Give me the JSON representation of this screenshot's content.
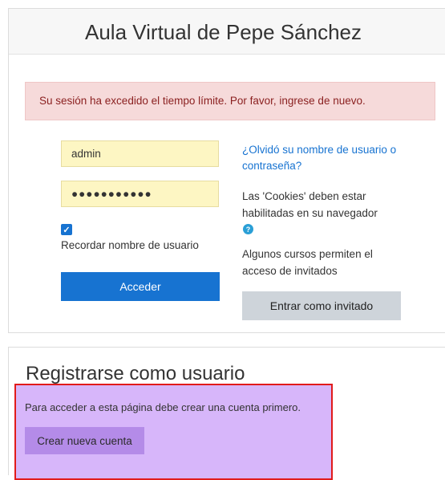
{
  "header": {
    "title": "Aula Virtual de Pepe Sánchez"
  },
  "alert": {
    "message": "Su sesión ha excedido el tiempo límite. Por favor, ingrese de nuevo."
  },
  "login": {
    "username_value": "admin",
    "password_value": "●●●●●●●●●●●",
    "remember_label": "Recordar nombre de usuario",
    "remember_checked": true,
    "submit_label": "Acceder"
  },
  "side": {
    "forgot_link": "¿Olvidó su nombre de usuario o contraseña?",
    "cookies_notice": "Las 'Cookies' deben estar habilitadas en su navegador",
    "help_icon": "?",
    "guest_notice": "Algunos cursos permiten el acceso de invitados",
    "guest_button": "Entrar como invitado"
  },
  "signup": {
    "title": "Registrarse como usuario",
    "text": "Para acceder a esta página debe crear una cuenta primero.",
    "button": "Crear nueva cuenta"
  },
  "colors": {
    "primary": "#1773d1",
    "alert_bg": "#f6dada",
    "autofill_bg": "#fdf6c3",
    "highlight": "#d7b6fa",
    "highlight_border": "#e11b1b"
  }
}
